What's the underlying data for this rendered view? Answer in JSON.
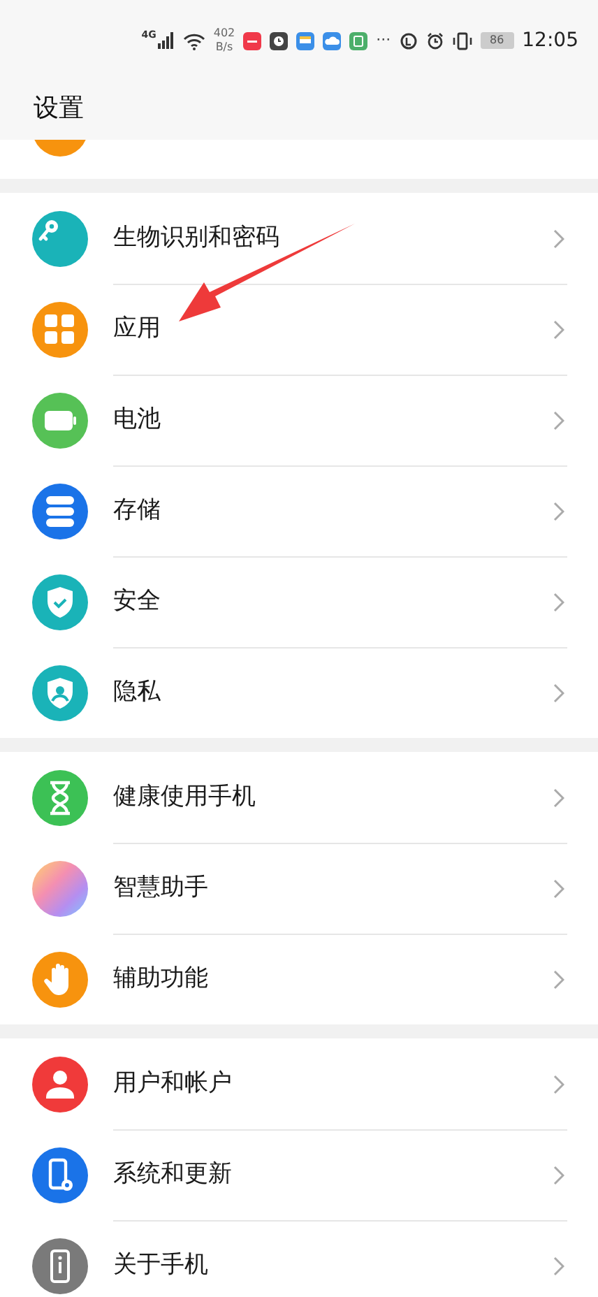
{
  "status_bar": {
    "network": "4G",
    "speed_value": "402",
    "speed_unit": "B/s",
    "more": "···",
    "battery": "86",
    "time": "12:05"
  },
  "title": "设置",
  "top_partial": {
    "color": "#f7930e"
  },
  "groups": [
    [
      {
        "label": "生物识别和密码",
        "kind": "key",
        "color": "#1ab3b8"
      },
      {
        "label": "应用",
        "kind": "apps",
        "color": "#f7930e"
      },
      {
        "label": "电池",
        "kind": "battery",
        "color": "#56c156"
      },
      {
        "label": "存储",
        "kind": "storage",
        "color": "#1a73e8"
      },
      {
        "label": "安全",
        "kind": "shield",
        "color": "#1ab3b8"
      },
      {
        "label": "隐私",
        "kind": "privacy",
        "color": "#1ab3b8"
      }
    ],
    [
      {
        "label": "健康使用手机",
        "kind": "hourglass",
        "color": "#3cc155"
      },
      {
        "label": "智慧助手",
        "kind": "orb"
      },
      {
        "label": "辅助功能",
        "kind": "hand",
        "color": "#f7930e"
      }
    ],
    [
      {
        "label": "用户和帐户",
        "kind": "user",
        "color": "#f03a3a"
      },
      {
        "label": "系统和更新",
        "kind": "gear",
        "color": "#1a73e8"
      },
      {
        "label": "关于手机",
        "kind": "info",
        "color": "#7a7a7a"
      }
    ]
  ]
}
